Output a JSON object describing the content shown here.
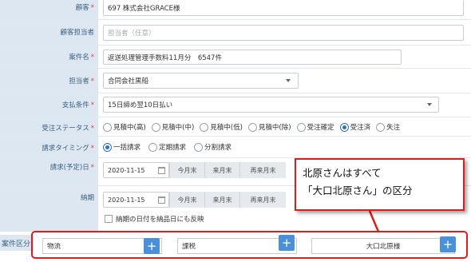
{
  "form": {
    "customer": {
      "label": "顧客",
      "value": "697 株式会社GRACE様"
    },
    "customer_contact": {
      "label": "顧客担当者",
      "placeholder": "担当者（任意）"
    },
    "case_name": {
      "label": "案件名",
      "value": "返送処理管理手数料11月分　6547件"
    },
    "assignee": {
      "label": "担当者",
      "value": "合同会社黒船"
    },
    "payment_terms": {
      "label": "支払条件",
      "value": "15日締め翌10日払い"
    },
    "order_status": {
      "label": "受注ステータス",
      "options": [
        "見積中(高)",
        "見積中(中)",
        "見積中(低)",
        "見積中(除)",
        "受注確定",
        "受注済",
        "失注"
      ],
      "selected": "受注済"
    },
    "billing_timing": {
      "label": "請求タイミング",
      "options": [
        "一括請求",
        "定期請求",
        "分割請求"
      ],
      "selected": "一括請求"
    },
    "billing_date": {
      "label": "請求(予定)日",
      "value": "2020-11-15",
      "quick_buttons": [
        "今月末",
        "来月末",
        "再来月末"
      ]
    },
    "delivery_date": {
      "label": "納期",
      "value": "2020-11-15",
      "quick_buttons": [
        "今月末",
        "来月末",
        "再来月末"
      ],
      "reflect_label": "納期の日付を納品日にも反映"
    }
  },
  "case_category": {
    "label": "案件区分",
    "fields": [
      "物流",
      "課税",
      "大口北原様"
    ],
    "add_symbol": "+"
  },
  "annotation": {
    "line1": "北原さんはすべて",
    "line2": "「大口北原さん」の区分",
    "color": "#e01b1b"
  }
}
